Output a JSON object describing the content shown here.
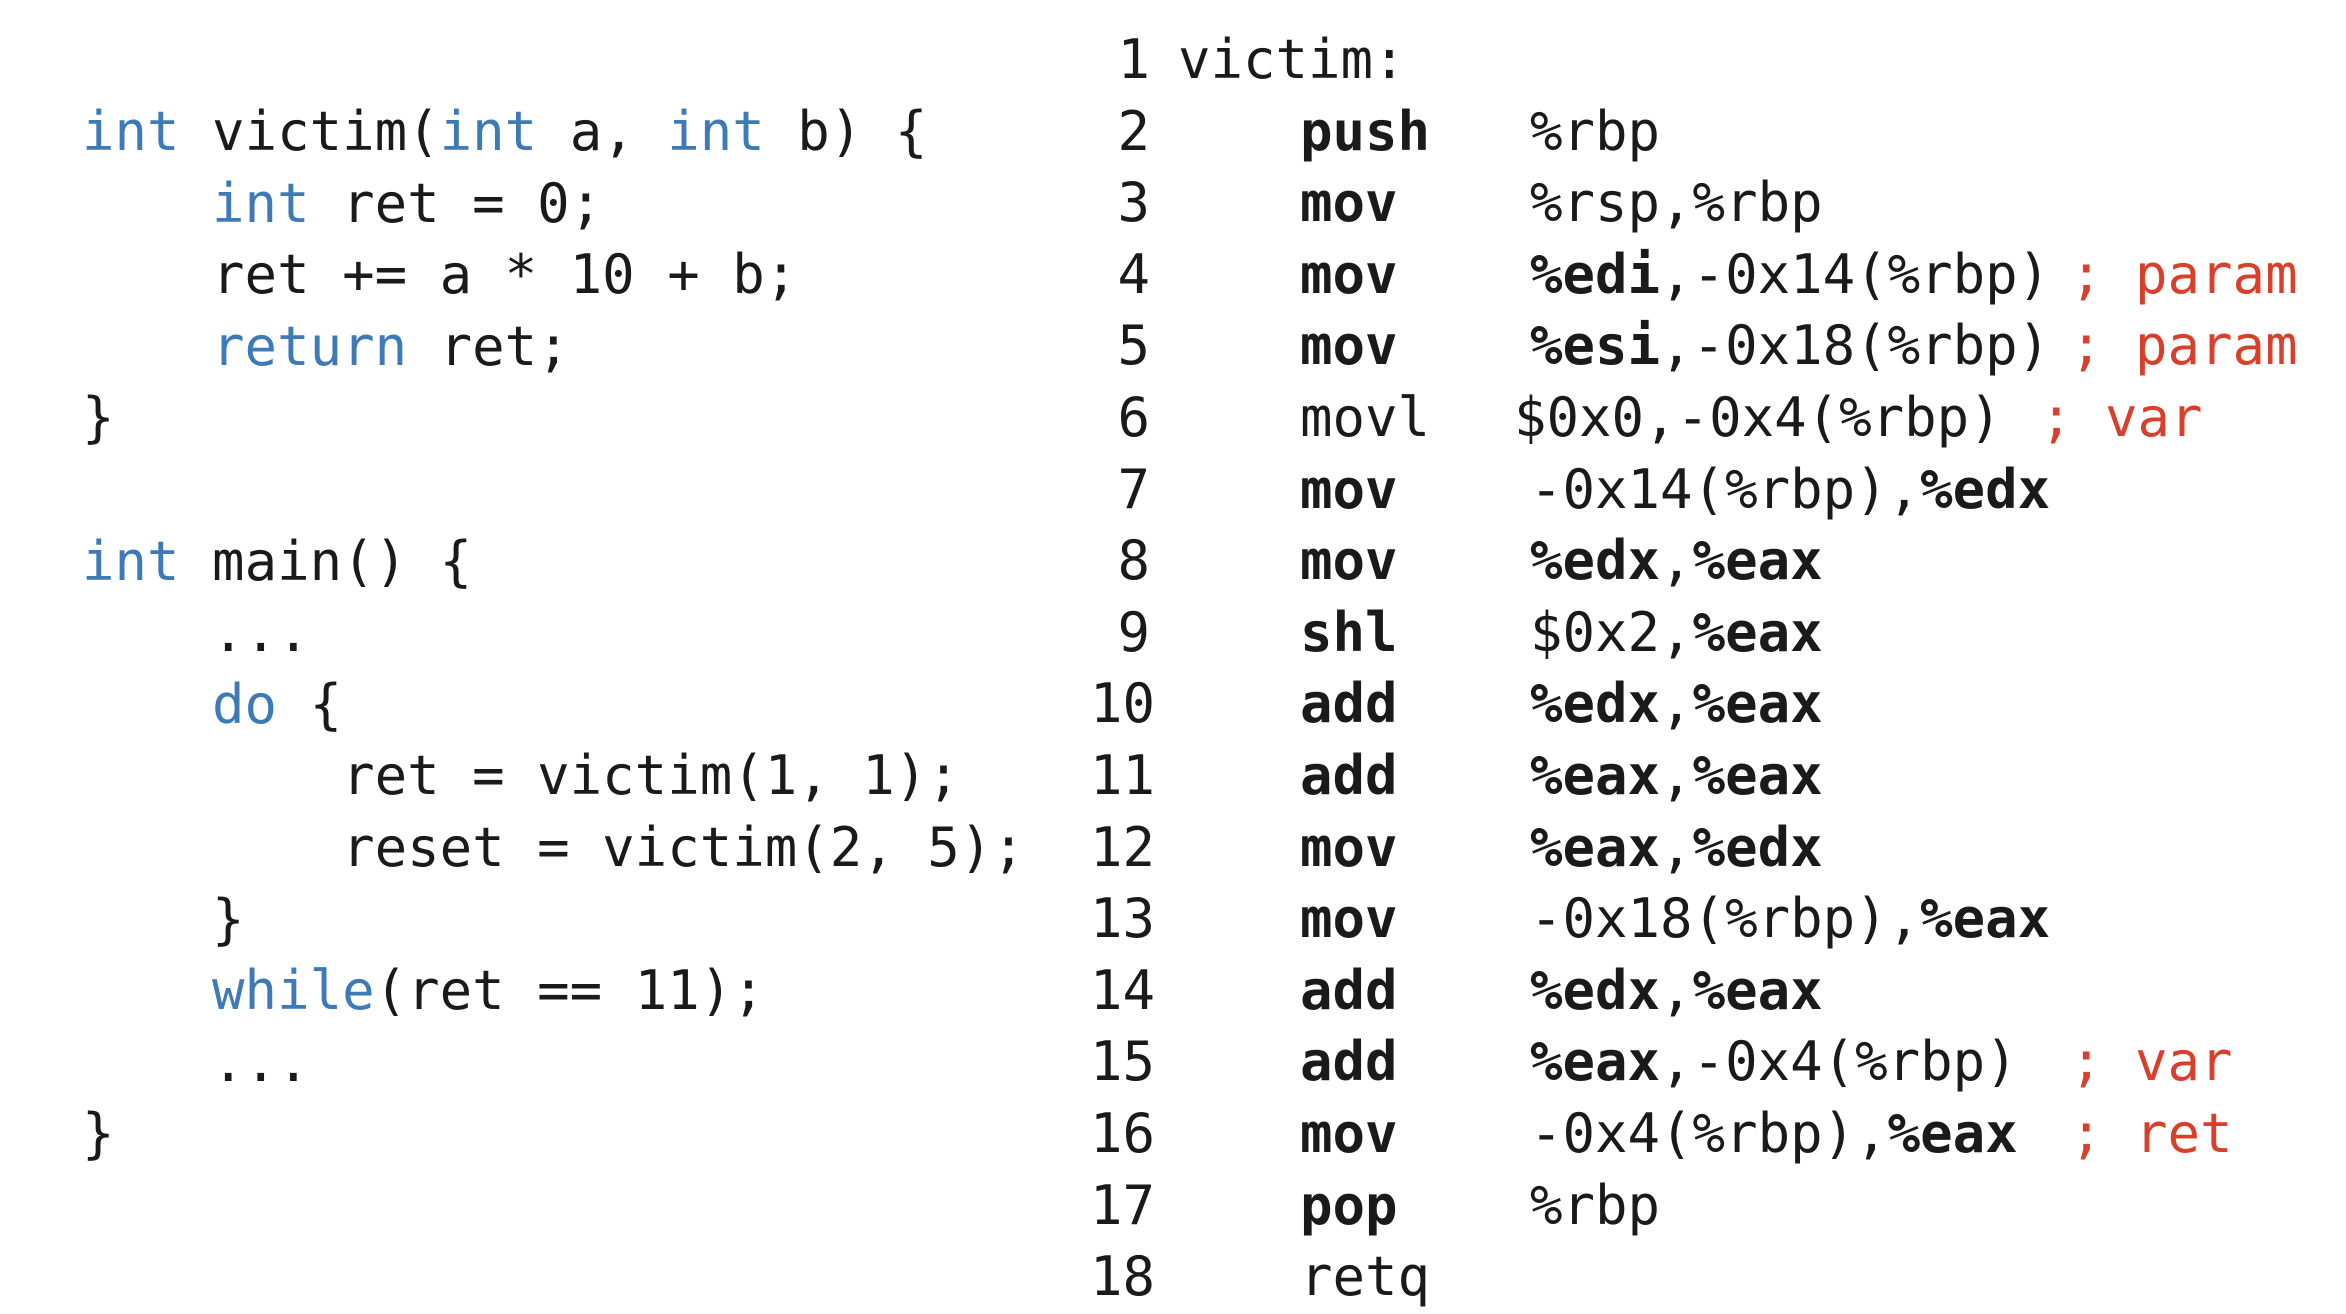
{
  "c_source": {
    "lines": [
      [
        {
          "t": "int",
          "k": 1
        },
        {
          "t": " victim("
        },
        {
          "t": "int",
          "k": 1
        },
        {
          "t": " a, "
        },
        {
          "t": "int",
          "k": 1
        },
        {
          "t": " b) {"
        }
      ],
      [
        {
          "t": "    "
        },
        {
          "t": "int",
          "k": 1
        },
        {
          "t": " ret = 0;"
        }
      ],
      [
        {
          "t": "    ret += a * 10 + b;"
        }
      ],
      [
        {
          "t": "    "
        },
        {
          "t": "return",
          "k": 1
        },
        {
          "t": " ret;"
        }
      ],
      [
        {
          "t": "}"
        }
      ],
      [],
      [
        {
          "t": "int",
          "k": 1
        },
        {
          "t": " main() {"
        }
      ],
      [
        {
          "t": "    ..."
        }
      ],
      [
        {
          "t": "    "
        },
        {
          "t": "do",
          "k": 1
        },
        {
          "t": " {"
        }
      ],
      [
        {
          "t": "        ret = victim(1, 1);"
        }
      ],
      [
        {
          "t": "        reset = victim(2, 5);"
        }
      ],
      [
        {
          "t": "    }"
        }
      ],
      [
        {
          "t": "    "
        },
        {
          "t": "while",
          "k": 1
        },
        {
          "t": "(ret == 11);"
        }
      ],
      [
        {
          "t": "    ..."
        }
      ],
      [
        {
          "t": "}"
        }
      ]
    ]
  },
  "assembly": {
    "label_line": {
      "num": "1",
      "text": "victim:"
    },
    "lines": [
      {
        "num": "2",
        "op": "push",
        "bold": true,
        "operands": [
          {
            "t": "%rbp"
          }
        ],
        "comment": ""
      },
      {
        "num": "3",
        "op": "mov",
        "bold": true,
        "operands": [
          {
            "t": "%rsp,%rbp"
          }
        ],
        "comment": ""
      },
      {
        "num": "4",
        "op": "mov",
        "bold": true,
        "operands": [
          {
            "t": "%edi",
            "b": 1
          },
          {
            "t": ",-0x14(%rbp)"
          }
        ],
        "comment": "; param"
      },
      {
        "num": "5",
        "op": "mov",
        "bold": true,
        "operands": [
          {
            "t": "%esi",
            "b": 1
          },
          {
            "t": ",-0x18(%rbp)"
          }
        ],
        "comment": "; param"
      },
      {
        "num": "6",
        "op": "movl",
        "bold": false,
        "operands": [
          {
            "t": "$0x0,-0x4(%rbp)"
          }
        ],
        "comment": "; var"
      },
      {
        "num": "7",
        "op": "mov",
        "bold": true,
        "operands": [
          {
            "t": "-0x14(%rbp),"
          },
          {
            "t": "%edx",
            "b": 1
          }
        ],
        "comment": ""
      },
      {
        "num": "8",
        "op": "mov",
        "bold": true,
        "operands": [
          {
            "t": "%edx",
            "b": 1
          },
          {
            "t": ","
          },
          {
            "t": "%eax",
            "b": 1
          }
        ],
        "comment": ""
      },
      {
        "num": "9",
        "op": "shl",
        "bold": true,
        "operands": [
          {
            "t": "$0x2,"
          },
          {
            "t": "%eax",
            "b": 1
          }
        ],
        "comment": ""
      },
      {
        "num": "10",
        "op": "add",
        "bold": true,
        "operands": [
          {
            "t": "%edx",
            "b": 1
          },
          {
            "t": ","
          },
          {
            "t": "%eax",
            "b": 1
          }
        ],
        "comment": ""
      },
      {
        "num": "11",
        "op": "add",
        "bold": true,
        "operands": [
          {
            "t": "%eax",
            "b": 1
          },
          {
            "t": ","
          },
          {
            "t": "%eax",
            "b": 1
          }
        ],
        "comment": ""
      },
      {
        "num": "12",
        "op": "mov",
        "bold": true,
        "operands": [
          {
            "t": "%eax",
            "b": 1
          },
          {
            "t": ","
          },
          {
            "t": "%edx",
            "b": 1
          }
        ],
        "comment": ""
      },
      {
        "num": "13",
        "op": "mov",
        "bold": true,
        "operands": [
          {
            "t": "-0x18(%rbp),"
          },
          {
            "t": "%eax",
            "b": 1
          }
        ],
        "comment": ""
      },
      {
        "num": "14",
        "op": "add",
        "bold": true,
        "operands": [
          {
            "t": "%edx",
            "b": 1
          },
          {
            "t": ","
          },
          {
            "t": "%eax",
            "b": 1
          }
        ],
        "comment": ""
      },
      {
        "num": "15",
        "op": "add",
        "bold": true,
        "operands": [
          {
            "t": "%eax",
            "b": 1
          },
          {
            "t": ",-0x4(%rbp)"
          }
        ],
        "comment": "; var"
      },
      {
        "num": "16",
        "op": "mov",
        "bold": true,
        "operands": [
          {
            "t": "-0x4(%rbp),"
          },
          {
            "t": "%eax",
            "b": 1
          }
        ],
        "comment": "; ret"
      },
      {
        "num": "17",
        "op": "pop",
        "bold": true,
        "operands": [
          {
            "t": "%rbp"
          }
        ],
        "comment": ""
      },
      {
        "num": "18",
        "op": "retq",
        "bold": false,
        "operands": [],
        "comment": ""
      }
    ]
  },
  "colors": {
    "keyword": "#3d7ab7",
    "comment": "#d9402b",
    "text": "#1a1a1a"
  }
}
